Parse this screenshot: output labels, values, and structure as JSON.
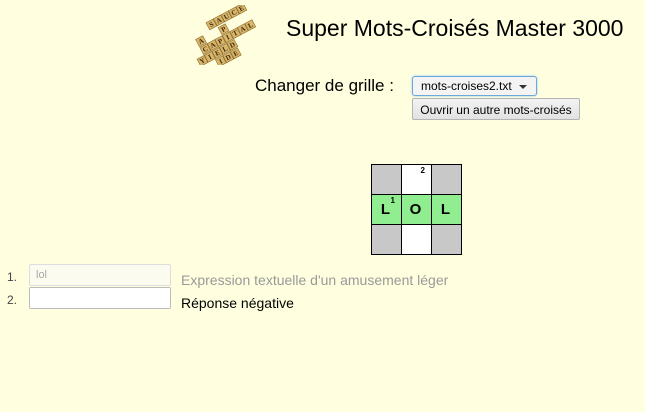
{
  "header": {
    "title": "Super Mots-Croisés Master 3000",
    "logo_tiles": [
      "S",
      "A",
      "U",
      "C",
      "E",
      "A",
      "P",
      "C",
      "A",
      "P",
      "I",
      "T",
      "A",
      "L",
      "Y",
      "I",
      "E",
      "L",
      "D",
      "I",
      "D",
      "E"
    ]
  },
  "grid_picker": {
    "label": "Changer de grille :",
    "selected": "mots-croises2.txt",
    "other_button": "Ouvrir un autre mots-croisés"
  },
  "crossword": {
    "rows": [
      [
        {
          "type": "black"
        },
        {
          "type": "white",
          "num": "2",
          "letter": ""
        },
        {
          "type": "black"
        }
      ],
      [
        {
          "type": "active",
          "num": "1",
          "letter": "L"
        },
        {
          "type": "active",
          "letter": "O"
        },
        {
          "type": "active",
          "letter": "L"
        }
      ],
      [
        {
          "type": "black"
        },
        {
          "type": "white",
          "letter": ""
        },
        {
          "type": "black"
        }
      ]
    ]
  },
  "clues": [
    {
      "num": "1.",
      "value": "lol",
      "placeholder": "",
      "text": "Expression textuelle d'un amusement léger",
      "solved": true
    },
    {
      "num": "2.",
      "value": "",
      "placeholder": "",
      "text": "Réponse négative",
      "solved": false
    }
  ],
  "colors": {
    "background": "#ffffe0",
    "active_cell": "#90ee90",
    "black_cell": "#c8c8c8"
  }
}
